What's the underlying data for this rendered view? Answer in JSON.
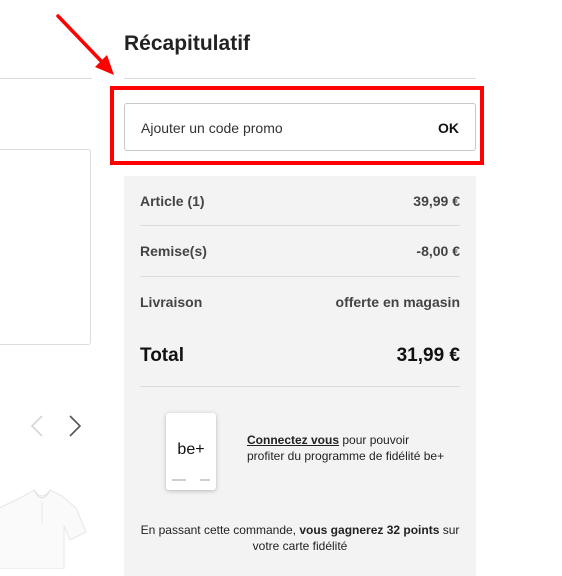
{
  "summary": {
    "title": "Récapitulatif",
    "promo": {
      "placeholder": "Ajouter un code promo",
      "ok_label": "OK"
    },
    "rows": [
      {
        "label": "Article (1)",
        "value": "39,99 €"
      },
      {
        "label": "Remise(s)",
        "value": "-8,00 €"
      },
      {
        "label": "Livraison",
        "value": "offerte en magasin"
      }
    ],
    "total": {
      "label": "Total",
      "value": "31,99 €"
    },
    "loyalty": {
      "card_brand": "be+",
      "link_text": "Connectez vous",
      "text": " pour pouvoir profiter du programme de fidélité be+"
    },
    "points": {
      "prefix": "En passant cette commande, ",
      "bold": "vous gagnerez 32 points",
      "suffix": " sur votre carte fidélité"
    }
  },
  "colors": {
    "highlight": "#ff0000",
    "panel_bg": "#f3f3f3"
  },
  "icons": [
    "chevron-left-icon",
    "chevron-right-icon",
    "annotation-arrow-icon"
  ]
}
